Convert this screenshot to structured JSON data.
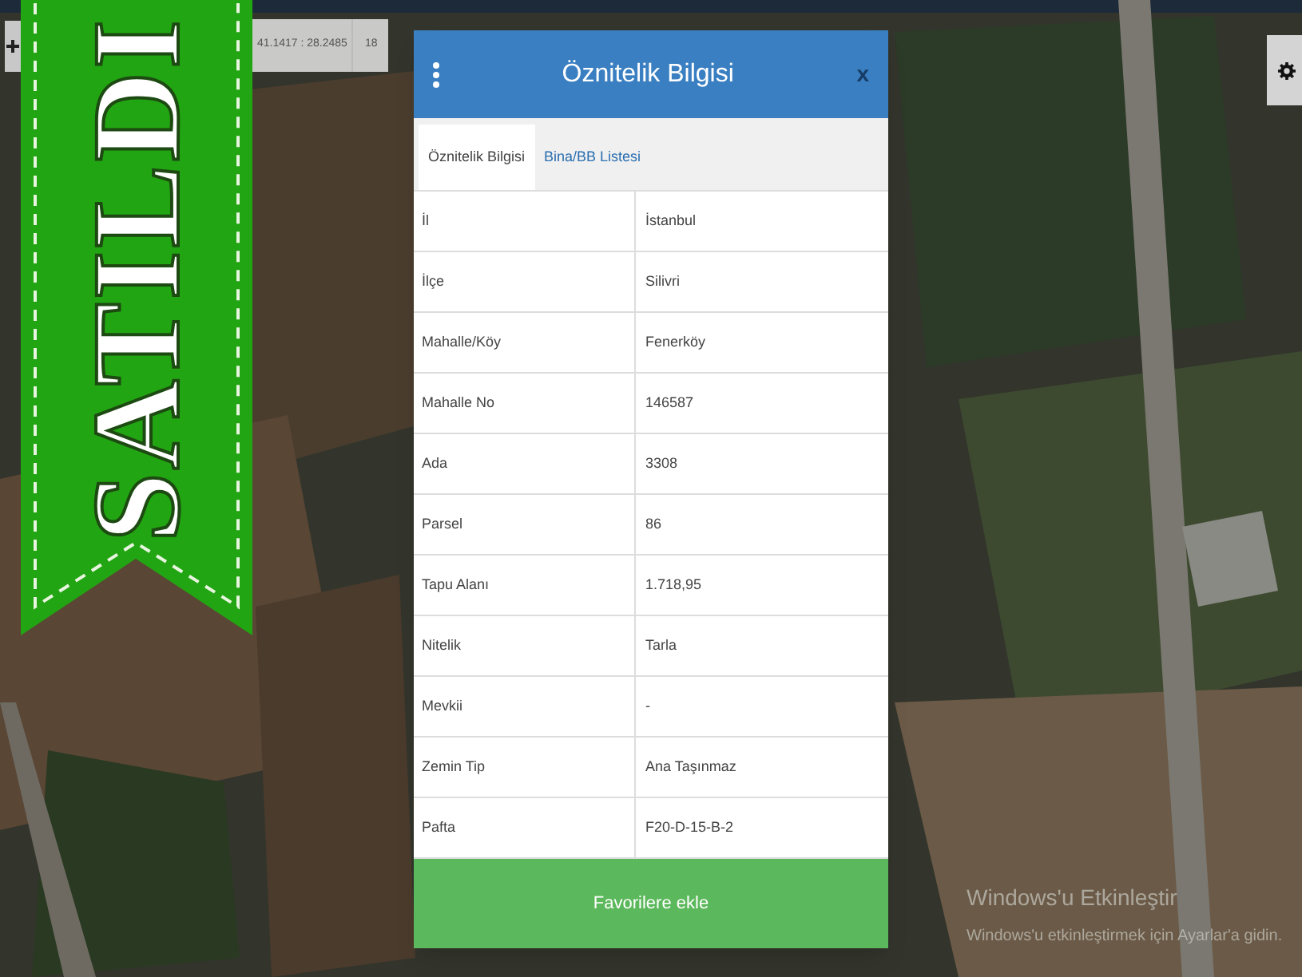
{
  "coordinates": {
    "value": "41.1417 : 28.2485",
    "zoom": "18"
  },
  "banner": {
    "text": "SATILDI"
  },
  "dialog": {
    "title": "Öznitelik Bilgisi",
    "close": "x",
    "tabs": [
      {
        "label": "Öznitelik Bilgisi",
        "selected": true
      },
      {
        "label": "Bina/BB Listesi",
        "selected": false
      }
    ],
    "rows": [
      {
        "name": "İl",
        "value": "İstanbul"
      },
      {
        "name": "İlçe",
        "value": "Silivri"
      },
      {
        "name": "Mahalle/Köy",
        "value": "Fenerköy"
      },
      {
        "name": "Mahalle No",
        "value": "146587"
      },
      {
        "name": "Ada",
        "value": "3308"
      },
      {
        "name": "Parsel",
        "value": "86"
      },
      {
        "name": "Tapu Alanı",
        "value": "1.718,95"
      },
      {
        "name": "Nitelik",
        "value": "Tarla"
      },
      {
        "name": "Mevkii",
        "value": "-"
      },
      {
        "name": "Zemin Tip",
        "value": "Ana Taşınmaz"
      },
      {
        "name": "Pafta",
        "value": "F20-D-15-B-2"
      }
    ],
    "button": "Favorilere ekle"
  },
  "activation": {
    "title": "Windows'u Etkinleştir",
    "message": "Windows'u etkinleştirmek için Ayarlar'a gidin."
  }
}
